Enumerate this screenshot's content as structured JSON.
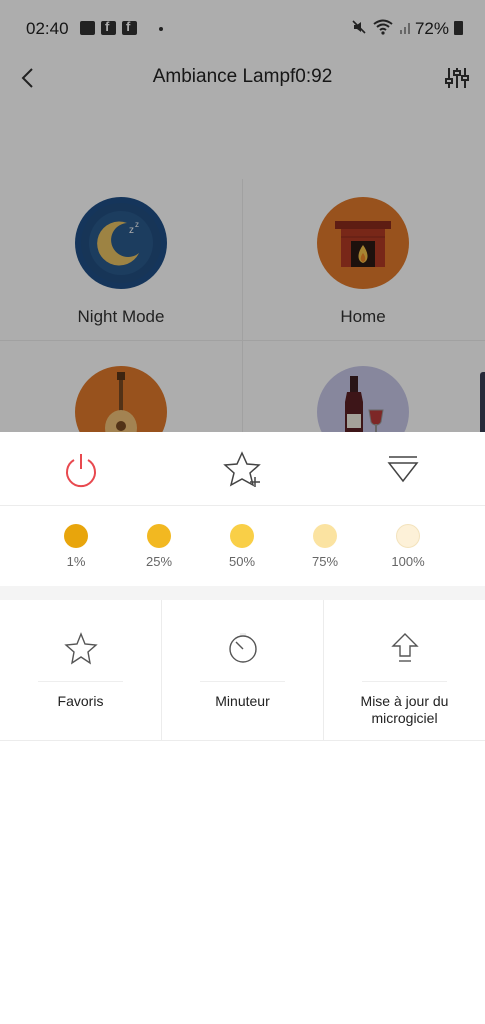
{
  "status": {
    "time": "02:40",
    "battery": "72%"
  },
  "header": {
    "title": "Ambiance Lampf0:92"
  },
  "scenes": [
    {
      "label": "Night Mode",
      "icon": "moon-icon",
      "color": "#1f4f86"
    },
    {
      "label": "Home",
      "icon": "fireplace-icon",
      "color": "#e07a2c"
    },
    {
      "label": "",
      "icon": "guitar-icon",
      "color": "#e07a2c"
    },
    {
      "label": "",
      "icon": "wine-icon",
      "color": "#c8c8e8"
    }
  ],
  "controls": {
    "power_icon": "power-icon",
    "favorite_add_icon": "star-plus-icon",
    "collapse_icon": "triangle-down-icon",
    "power_color": "#e8494f"
  },
  "brightness": [
    {
      "label": "1%",
      "color": "#e8a50c"
    },
    {
      "label": "25%",
      "color": "#f2b821"
    },
    {
      "label": "50%",
      "color": "#f9cf47"
    },
    {
      "label": "75%",
      "color": "#fbe3a1"
    },
    {
      "label": "100%",
      "color": "#fdf1d8"
    }
  ],
  "menu": [
    {
      "label": "Favoris",
      "icon": "star-icon"
    },
    {
      "label": "Minuteur",
      "icon": "timer-icon"
    },
    {
      "label": "Mise à jour du microgiciel",
      "icon": "upload-arrow-icon"
    }
  ]
}
